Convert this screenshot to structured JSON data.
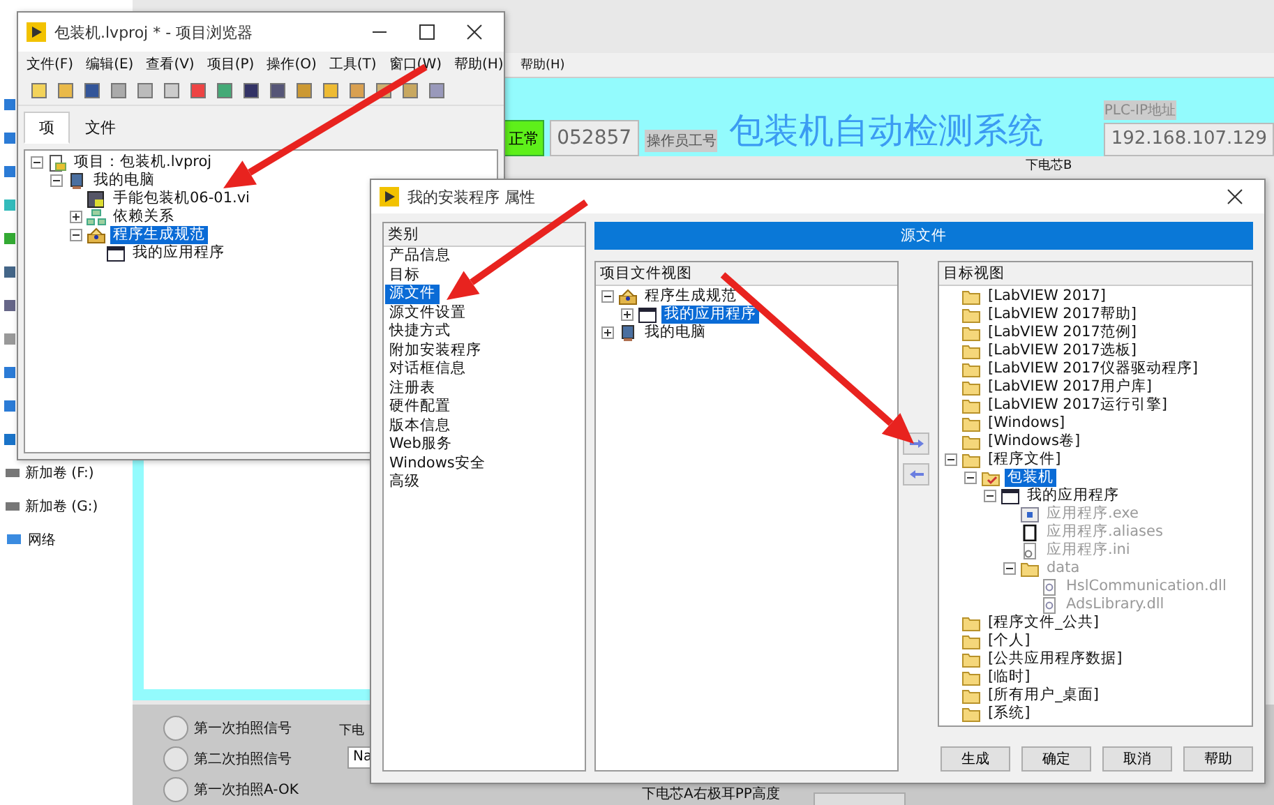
{
  "desktop": {
    "items": [
      {
        "label": "新加卷 (F:)",
        "kind": "drive"
      },
      {
        "label": "新加卷 (G:)",
        "kind": "drive"
      },
      {
        "label": "网络",
        "kind": "network"
      }
    ]
  },
  "app": {
    "menu": [
      "帮助(H)"
    ],
    "status_button": "正常",
    "operator_id": "052857",
    "operator_label": "操作员工号",
    "title": "包装机自动检测系统",
    "plc_label": "PLC-IP地址",
    "plc_ip": "192.168.107.129",
    "section_label": "下电芯B",
    "signals": [
      {
        "label": "第一次拍照信号",
        "on": false
      },
      {
        "label": "第二次拍照信号",
        "on": false
      },
      {
        "label": "第一次拍照A-OK",
        "on": false
      }
    ],
    "bottom_label": "下电",
    "bottom_field": "Na",
    "height_label": "下电芯A右极耳PP高度"
  },
  "project_window": {
    "title": "包装机.lvproj * - 项目浏览器",
    "menu": [
      "文件(F)",
      "编辑(E)",
      "查看(V)",
      "项目(P)",
      "操作(O)",
      "工具(T)",
      "窗口(W)",
      "帮助(H)"
    ],
    "tabs": [
      {
        "label": "项",
        "selected": true
      },
      {
        "label": "文件",
        "selected": false
      }
    ],
    "tree": [
      {
        "label": "项目：包装机.lvproj",
        "kind": "project",
        "expanded": true,
        "selected": false,
        "children": [
          {
            "label": "我的电脑",
            "kind": "computer",
            "expanded": true,
            "selected": false,
            "children": [
              {
                "label": "手能包装机06-01.vi",
                "kind": "vi",
                "selected": false
              },
              {
                "label": "依赖关系",
                "kind": "deps",
                "expanded": false,
                "selected": false
              },
              {
                "label": "程序生成规范",
                "kind": "build",
                "expanded": true,
                "selected": true,
                "children": [
                  {
                    "label": "我的应用程序",
                    "kind": "app",
                    "selected": false
                  }
                ]
              }
            ]
          }
        ]
      }
    ]
  },
  "dialog": {
    "title": "我的安装程序 属性",
    "category_header": "类别",
    "categories": [
      {
        "label": "产品信息",
        "selected": false
      },
      {
        "label": "目标",
        "selected": false
      },
      {
        "label": "源文件",
        "selected": true
      },
      {
        "label": "源文件设置",
        "selected": false
      },
      {
        "label": "快捷方式",
        "selected": false
      },
      {
        "label": "附加安装程序",
        "selected": false
      },
      {
        "label": "对话框信息",
        "selected": false
      },
      {
        "label": "注册表",
        "selected": false
      },
      {
        "label": "硬件配置",
        "selected": false
      },
      {
        "label": "版本信息",
        "selected": false
      },
      {
        "label": "Web服务",
        "selected": false
      },
      {
        "label": "Windows安全",
        "selected": false
      },
      {
        "label": "高级",
        "selected": false
      }
    ],
    "banner": "源文件",
    "source_header": "项目文件视图",
    "source_tree": [
      {
        "label": "程序生成规范",
        "kind": "build",
        "expanded": true,
        "selected": false,
        "children": [
          {
            "label": "我的应用程序",
            "kind": "app",
            "expanded": false,
            "selected": true
          }
        ]
      },
      {
        "label": "我的电脑",
        "kind": "computer",
        "expanded": false,
        "selected": false
      }
    ],
    "target_header": "目标视图",
    "target_tree": [
      {
        "label": "[LabVIEW 2017]",
        "kind": "folder",
        "selected": false,
        "dimmed": false
      },
      {
        "label": "[LabVIEW 2017帮助]",
        "kind": "folder",
        "selected": false,
        "dimmed": false
      },
      {
        "label": "[LabVIEW 2017范例]",
        "kind": "folder",
        "selected": false,
        "dimmed": false
      },
      {
        "label": "[LabVIEW 2017选板]",
        "kind": "folder",
        "selected": false,
        "dimmed": false
      },
      {
        "label": "[LabVIEW 2017仪器驱动程序]",
        "kind": "folder",
        "selected": false,
        "dimmed": false
      },
      {
        "label": "[LabVIEW 2017用户库]",
        "kind": "folder",
        "selected": false,
        "dimmed": false
      },
      {
        "label": "[LabVIEW 2017运行引擎]",
        "kind": "folder",
        "selected": false,
        "dimmed": false
      },
      {
        "label": "[Windows]",
        "kind": "folder",
        "selected": false,
        "dimmed": false
      },
      {
        "label": "[Windows卷]",
        "kind": "folder",
        "selected": false,
        "dimmed": false
      },
      {
        "label": "[程序文件]",
        "kind": "folder",
        "expanded": true,
        "selected": false,
        "dimmed": false,
        "children": [
          {
            "label": "包装机",
            "kind": "folder_app",
            "expanded": true,
            "selected": true,
            "dimmed": false,
            "children": [
              {
                "label": "我的应用程序",
                "kind": "app",
                "expanded": true,
                "selected": false,
                "dimmed": false,
                "children": [
                  {
                    "label": "应用程序.exe",
                    "kind": "exe",
                    "selected": false,
                    "dimmed": true
                  },
                  {
                    "label": "应用程序.aliases",
                    "kind": "aliases",
                    "selected": false,
                    "dimmed": true
                  },
                  {
                    "label": "应用程序.ini",
                    "kind": "ini",
                    "selected": false,
                    "dimmed": true
                  },
                  {
                    "label": "data",
                    "kind": "folder",
                    "expanded": true,
                    "selected": false,
                    "dimmed": true,
                    "children": [
                      {
                        "label": "HslCommunication.dll",
                        "kind": "dll",
                        "selected": false,
                        "dimmed": true
                      },
                      {
                        "label": "AdsLibrary.dll",
                        "kind": "dll",
                        "selected": false,
                        "dimmed": true
                      }
                    ]
                  }
                ]
              }
            ]
          }
        ]
      },
      {
        "label": "[程序文件_公共]",
        "kind": "folder",
        "selected": false,
        "dimmed": false
      },
      {
        "label": "[个人]",
        "kind": "folder",
        "selected": false,
        "dimmed": false
      },
      {
        "label": "[公共应用程序数据]",
        "kind": "folder",
        "selected": false,
        "dimmed": false
      },
      {
        "label": "[临时]",
        "kind": "folder",
        "selected": false,
        "dimmed": false
      },
      {
        "label": "[所有用户_桌面]",
        "kind": "folder",
        "selected": false,
        "dimmed": false
      },
      {
        "label": "[系统]",
        "kind": "folder",
        "selected": false,
        "dimmed": false
      }
    ],
    "buttons": [
      "生成",
      "确定",
      "取消",
      "帮助"
    ]
  }
}
